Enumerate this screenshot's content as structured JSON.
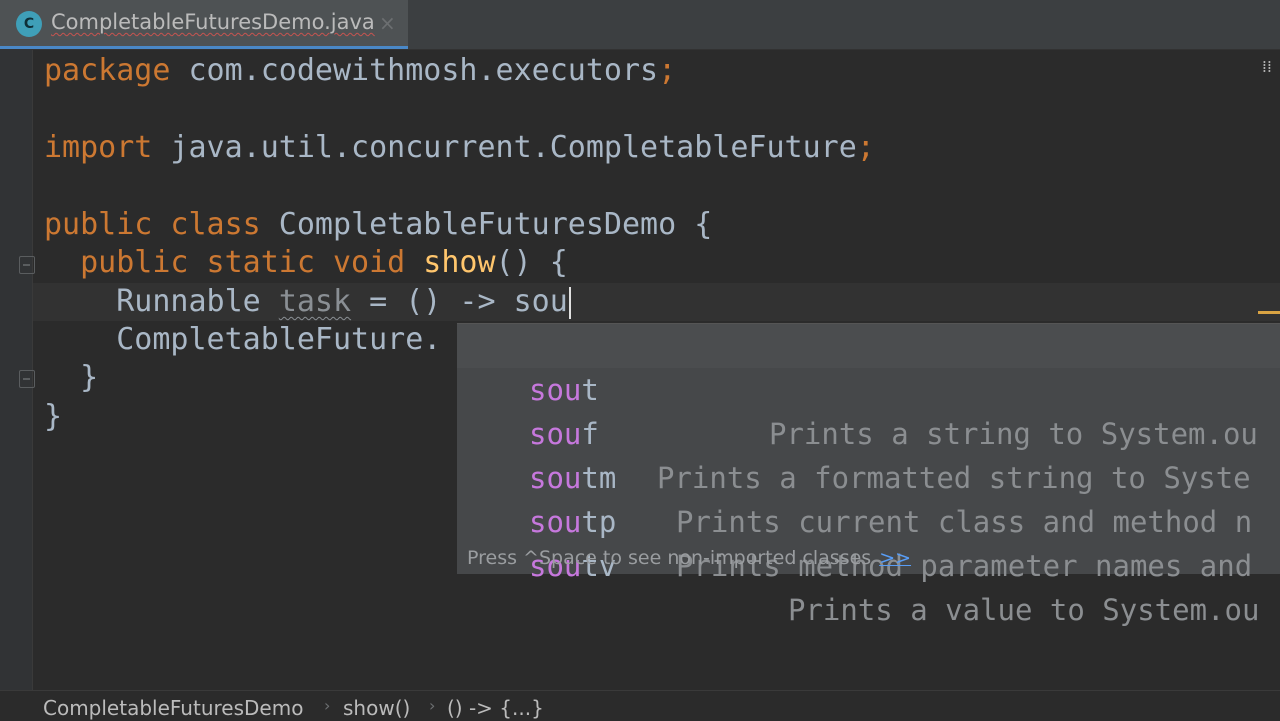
{
  "tab": {
    "icon_letter": "C",
    "title": "CompletableFuturesDemo.java",
    "close": "×"
  },
  "editor": {
    "lines": {
      "l1": {
        "kw": "package",
        "rest": " com.codewithmosh.executors",
        "semi": ";"
      },
      "l2": {
        "kw": "import",
        "rest": " java.util.concurrent.CompletableFuture",
        "semi": ";"
      },
      "l3": {
        "kw": "public class",
        "rest": " CompletableFuturesDemo {"
      },
      "l4": {
        "indent": "  ",
        "kw": "public static void",
        "space": " ",
        "fn": "show",
        "rest": "() {"
      },
      "l5": {
        "indent": "    ",
        "type": "Runnable ",
        "var": "task",
        "rest": " = () -> sou"
      },
      "l6": {
        "text": "    CompletableFuture."
      },
      "l7": {
        "text": "  }"
      },
      "l8": {
        "text": "}"
      }
    }
  },
  "completion": {
    "items": [
      {
        "match": "sou",
        "suffix": "t",
        "desc": "Prints a string to System.ou"
      },
      {
        "match": "sou",
        "suffix": "f",
        "desc": "Prints a formatted string to Syste"
      },
      {
        "match": "sou",
        "suffix": "tm",
        "desc": "Prints current class and method n"
      },
      {
        "match": "sou",
        "suffix": "tp",
        "desc": "Prints method parameter names and"
      },
      {
        "match": "sou",
        "suffix": "tv",
        "desc": "Prints a value to System.ou"
      }
    ],
    "hint": "Press ^Space to see non-imported classes",
    "hint_link": ">>"
  },
  "breadcrumb": {
    "items": [
      "CompletableFuturesDemo",
      "show()",
      "() -> {...}"
    ],
    "separator": "›"
  },
  "markers": {
    "scroll": "⁞⁞"
  },
  "colors": {
    "keyword": "#cc7832",
    "method": "#ffc66d",
    "text": "#a9b7c6",
    "match": "#c678dd",
    "link": "#589df6"
  }
}
